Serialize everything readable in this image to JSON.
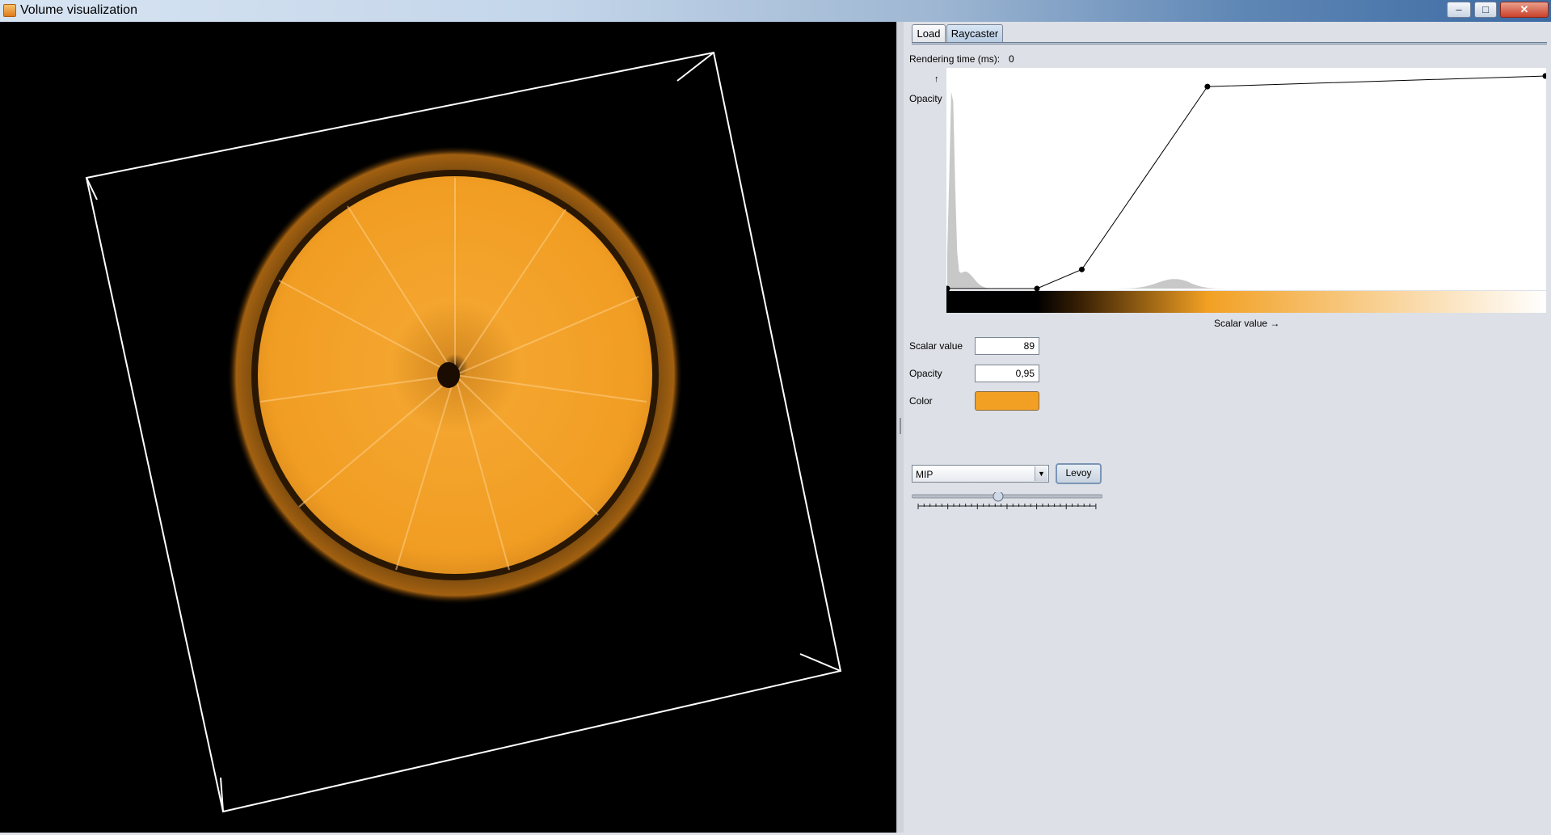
{
  "window": {
    "title": "Volume visualization",
    "controls": {
      "minimize": "–",
      "maximize": "□",
      "close": "✕"
    }
  },
  "viewport": {
    "background": "#000000",
    "bounding_box_color": "#ffffff",
    "volume_color": "#f2a023"
  },
  "tabs": [
    {
      "label": "Load",
      "selected": false
    },
    {
      "label": "Raycaster",
      "selected": true
    }
  ],
  "panel": {
    "rendering_time_label": "Rendering time (ms):",
    "rendering_time_value": "0",
    "opacity_axis_arrow": "↑",
    "opacity_axis_label": "Opacity",
    "scalar_axis_label": "Scalar value →",
    "fields": {
      "scalar_value_label": "Scalar value",
      "scalar_value": "89",
      "opacity_label": "Opacity",
      "opacity_value": "0,95",
      "color_label": "Color",
      "color_value": "#f2a023"
    },
    "mode_select": {
      "selected": "MIP",
      "arrow_icon": "chevron-down-icon"
    },
    "levoy_button": "Levoy",
    "slider_value": 0.45
  },
  "chart_data": {
    "type": "line",
    "title": "",
    "xlabel": "Scalar value →",
    "ylabel": "Opacity",
    "xlim": [
      0,
      1
    ],
    "ylim": [
      0,
      1
    ],
    "transfer_function_points": [
      {
        "x": 0.0,
        "y": 0.0
      },
      {
        "x": 0.15,
        "y": 0.0
      },
      {
        "x": 0.225,
        "y": 0.09
      },
      {
        "x": 0.435,
        "y": 0.95
      },
      {
        "x": 1.0,
        "y": 1.0
      }
    ],
    "colormap_stops": [
      {
        "pos": 0.0,
        "color": "#000000"
      },
      {
        "pos": 0.15,
        "color": "#000000"
      },
      {
        "pos": 0.225,
        "color": "#3a2104"
      },
      {
        "pos": 0.435,
        "color": "#f2a023"
      },
      {
        "pos": 1.0,
        "color": "#ffffff"
      }
    ],
    "histogram_color": "#c8c8c8"
  }
}
